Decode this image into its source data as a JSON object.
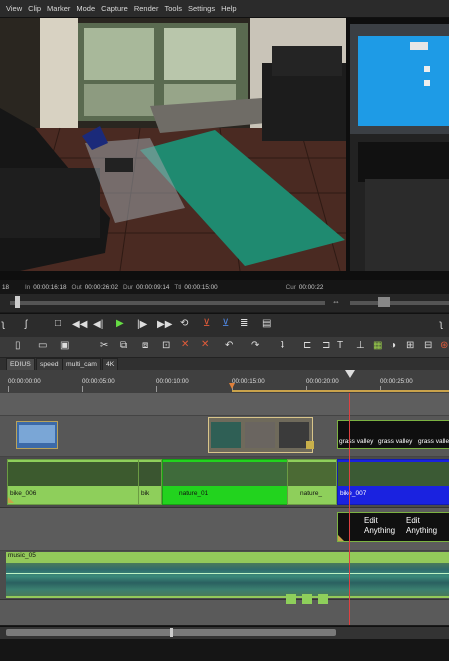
{
  "menu": [
    "View",
    "Clip",
    "Marker",
    "Mode",
    "Capture",
    "Render",
    "Tools",
    "Settings",
    "Help"
  ],
  "timecodes": {
    "in_label": "In",
    "in": "00:00:16:18",
    "out_label": "Out",
    "out": "00:00:26:02",
    "dur_label": "Dur",
    "dur": "00:00:09:14",
    "ttl_label": "Ttl",
    "ttl": "00:00:15:00",
    "left_partial": "18",
    "right_label": "Cur",
    "right_partial": "00:00:22"
  },
  "tabs": [
    "EDIUS",
    "speed",
    "multi_cam",
    "4K"
  ],
  "ruler": [
    "00:00:00:00",
    "00:00:05:00",
    "00:00:10:00",
    "00:00:15:00",
    "00:00:20:00",
    "00:00:25:00"
  ],
  "clips": {
    "bike_006": "bike_006",
    "bike_trunc": "bik",
    "nature_01": "nature_01",
    "nature_trunc": "nature_",
    "bike_007": "bike_007",
    "grass_valley": "grass valley",
    "edit_anything_1": "Edit",
    "edit_anything_2": "Anything",
    "music": "music_05"
  },
  "colors": {
    "video_clip": "#8ecf5b",
    "selected_clip": "#22d31e",
    "blue_clip": "#1a22e0",
    "audio_track": "#93c95a",
    "playhead": "#e04040"
  }
}
